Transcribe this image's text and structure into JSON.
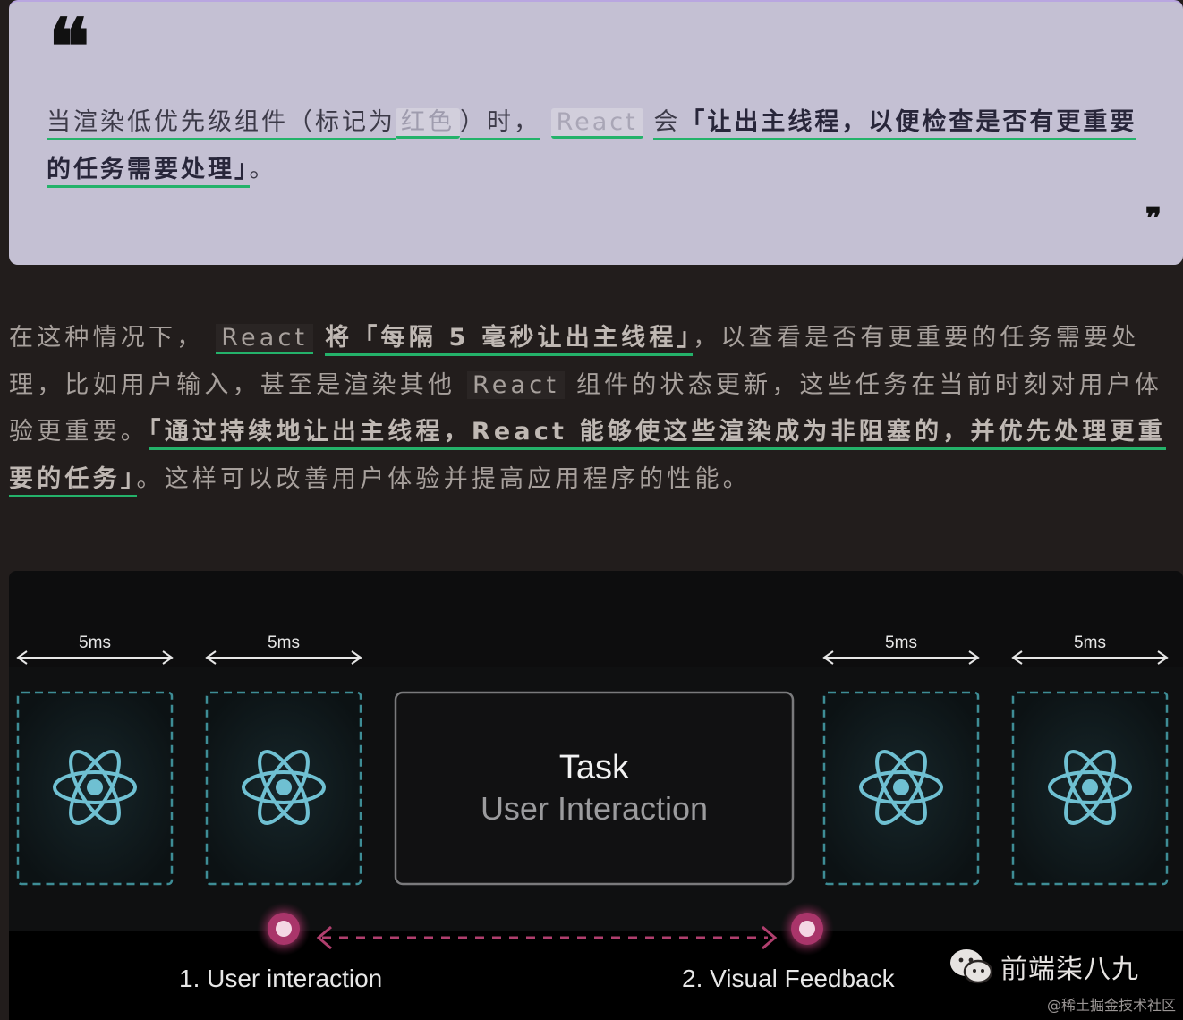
{
  "quote": {
    "t1": "当渲染低优先级组件（标记为",
    "code_red": "红色",
    "t2": "）时，",
    "code_react": "React",
    "t3": "会",
    "t4": "「让出主线程，以便检查是否有更重要的任务需要处理」",
    "t5": "。"
  },
  "paragraph": {
    "t1": "在这种情况下，",
    "code1": "React",
    "b1": "将「每隔 5 毫秒让出主线程」",
    "t2": "，以查看是否有更重要的任务需要处理，比如用户输入，甚至是渲染其他",
    "code2": "React",
    "t3": "组件的状态更新，这些任务在当前时刻对用户体验更重要。",
    "b2": "「通过持续地让出主线程，React 能够使这些渲染成为非阻塞的，并优先处理更重要的任务」",
    "t4": "。这样可以改善用户体验并提高应用程序的性能。"
  },
  "diagram": {
    "slices": [
      {
        "label": "5ms"
      },
      {
        "label": "5ms"
      },
      {
        "label": "5ms"
      },
      {
        "label": "5ms"
      }
    ],
    "task_title": "Task",
    "task_subtitle": "User Interaction",
    "step1": "1. User interaction",
    "step2": "2. Visual Feedback",
    "colors": {
      "slice_border": "#3e8d96",
      "atom": "#6fc0d2",
      "task_border": "#7a7a7c",
      "marker": "#c1447a",
      "connector": "#b03f6e"
    }
  },
  "watermark": {
    "label": "前端柒八九",
    "icon": "wechat-icon",
    "credit": "@稀土掘金技术社区"
  }
}
